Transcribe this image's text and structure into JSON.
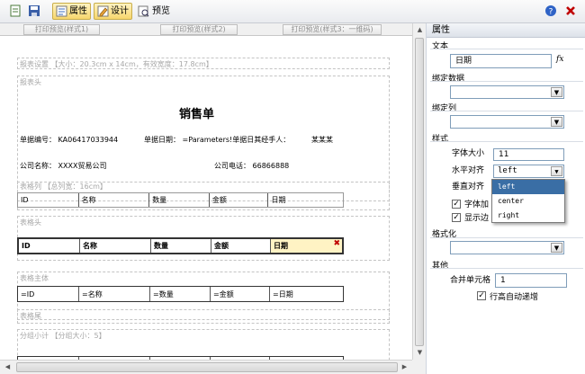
{
  "toolbar": {
    "attr_label": "属性",
    "design_label": "设计",
    "preview_label": "预览"
  },
  "tabs": [
    "打印预览(样式1)",
    "打印预览(样式2)",
    "打印预览(样式3：一维码)"
  ],
  "canvas": {
    "settings_label": "报表设置 【大小：20.3cm x 14cm，有效宽度：17.8cm】",
    "header_label": "报表头",
    "title": "销售单",
    "info1": "单据编号： KA06417033944",
    "info2": "单据日期： =Parameters!单据日其经手人：",
    "info3": "某某某",
    "company": "公司名称：  XXXX贸易公司",
    "phone": "公司电话：  66866888",
    "tablecols_label": "表格列 【总列宽：16cm】",
    "cols": [
      "ID",
      "名称",
      "数量",
      "金额",
      "日期"
    ],
    "tablehead_label": "表格头",
    "head_cells": [
      "ID",
      "名称",
      "数量",
      "金额",
      "日期"
    ],
    "body_label": "表格主体",
    "body_cells": [
      "=ID",
      "=名称",
      "=数量",
      "=金额",
      "=日期"
    ],
    "footer_label": "表格尾",
    "group_label": "分组小计 【分组大小：5】"
  },
  "panel": {
    "title": "属性",
    "text_label": "文本",
    "text_value": "日期",
    "fx": "fx",
    "bind_data_label": "绑定数据",
    "bind_col_label": "绑定列",
    "style_label": "样式",
    "font_size_label": "字体大小",
    "font_size_value": "11",
    "halign_label": "水平对齐",
    "halign_value": "left",
    "valign_label": "垂直对齐",
    "bold_label": "字体加",
    "border_label": "显示边",
    "format_label": "格式化",
    "other_label": "其他",
    "merge_label": "合并单元格",
    "merge_value": "1",
    "autogrow_label": "行高自动递增",
    "options": [
      "left",
      "center",
      "right"
    ]
  },
  "colors": {
    "accent": "#f7d66d",
    "selected": "#fff3c4",
    "close": "#c00000"
  }
}
